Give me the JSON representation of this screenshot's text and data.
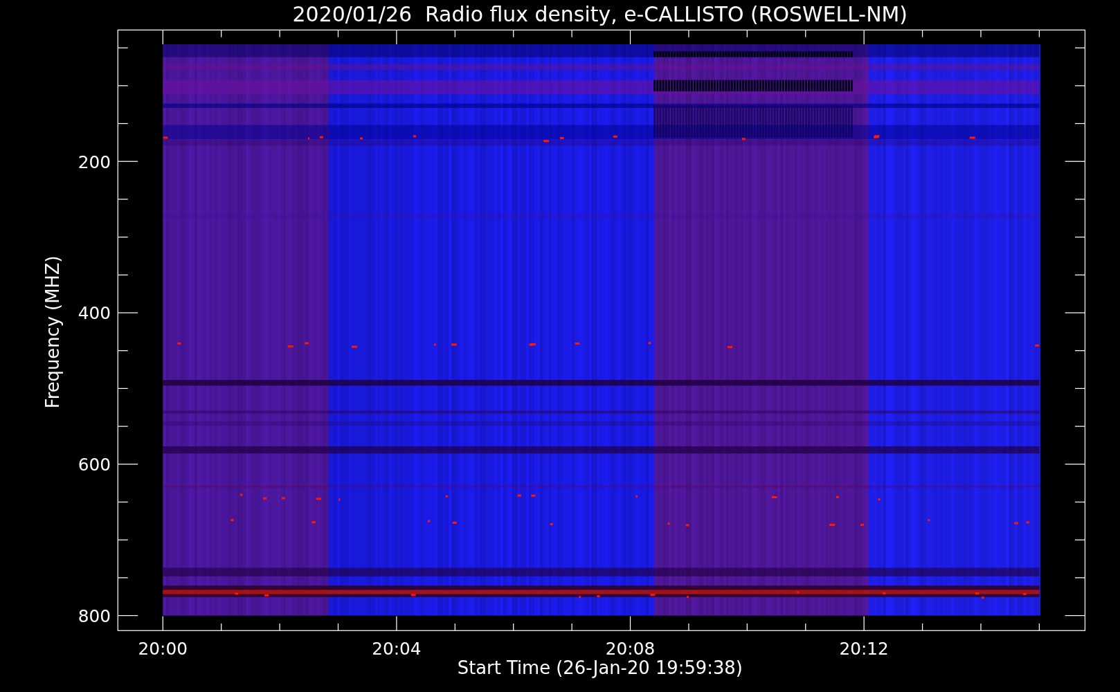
{
  "title": "2020/01/26  Radio flux density, e-CALLISTO (ROSWELL-NM)",
  "y_axis": {
    "label": "Frequency (MHZ)",
    "ticks": [
      "200",
      "400",
      "600",
      "800"
    ]
  },
  "x_axis": {
    "label": "Start Time (26-Jan-20 19:59:38)",
    "ticks": [
      "20:00",
      "20:04",
      "20:08",
      "20:12"
    ]
  }
}
